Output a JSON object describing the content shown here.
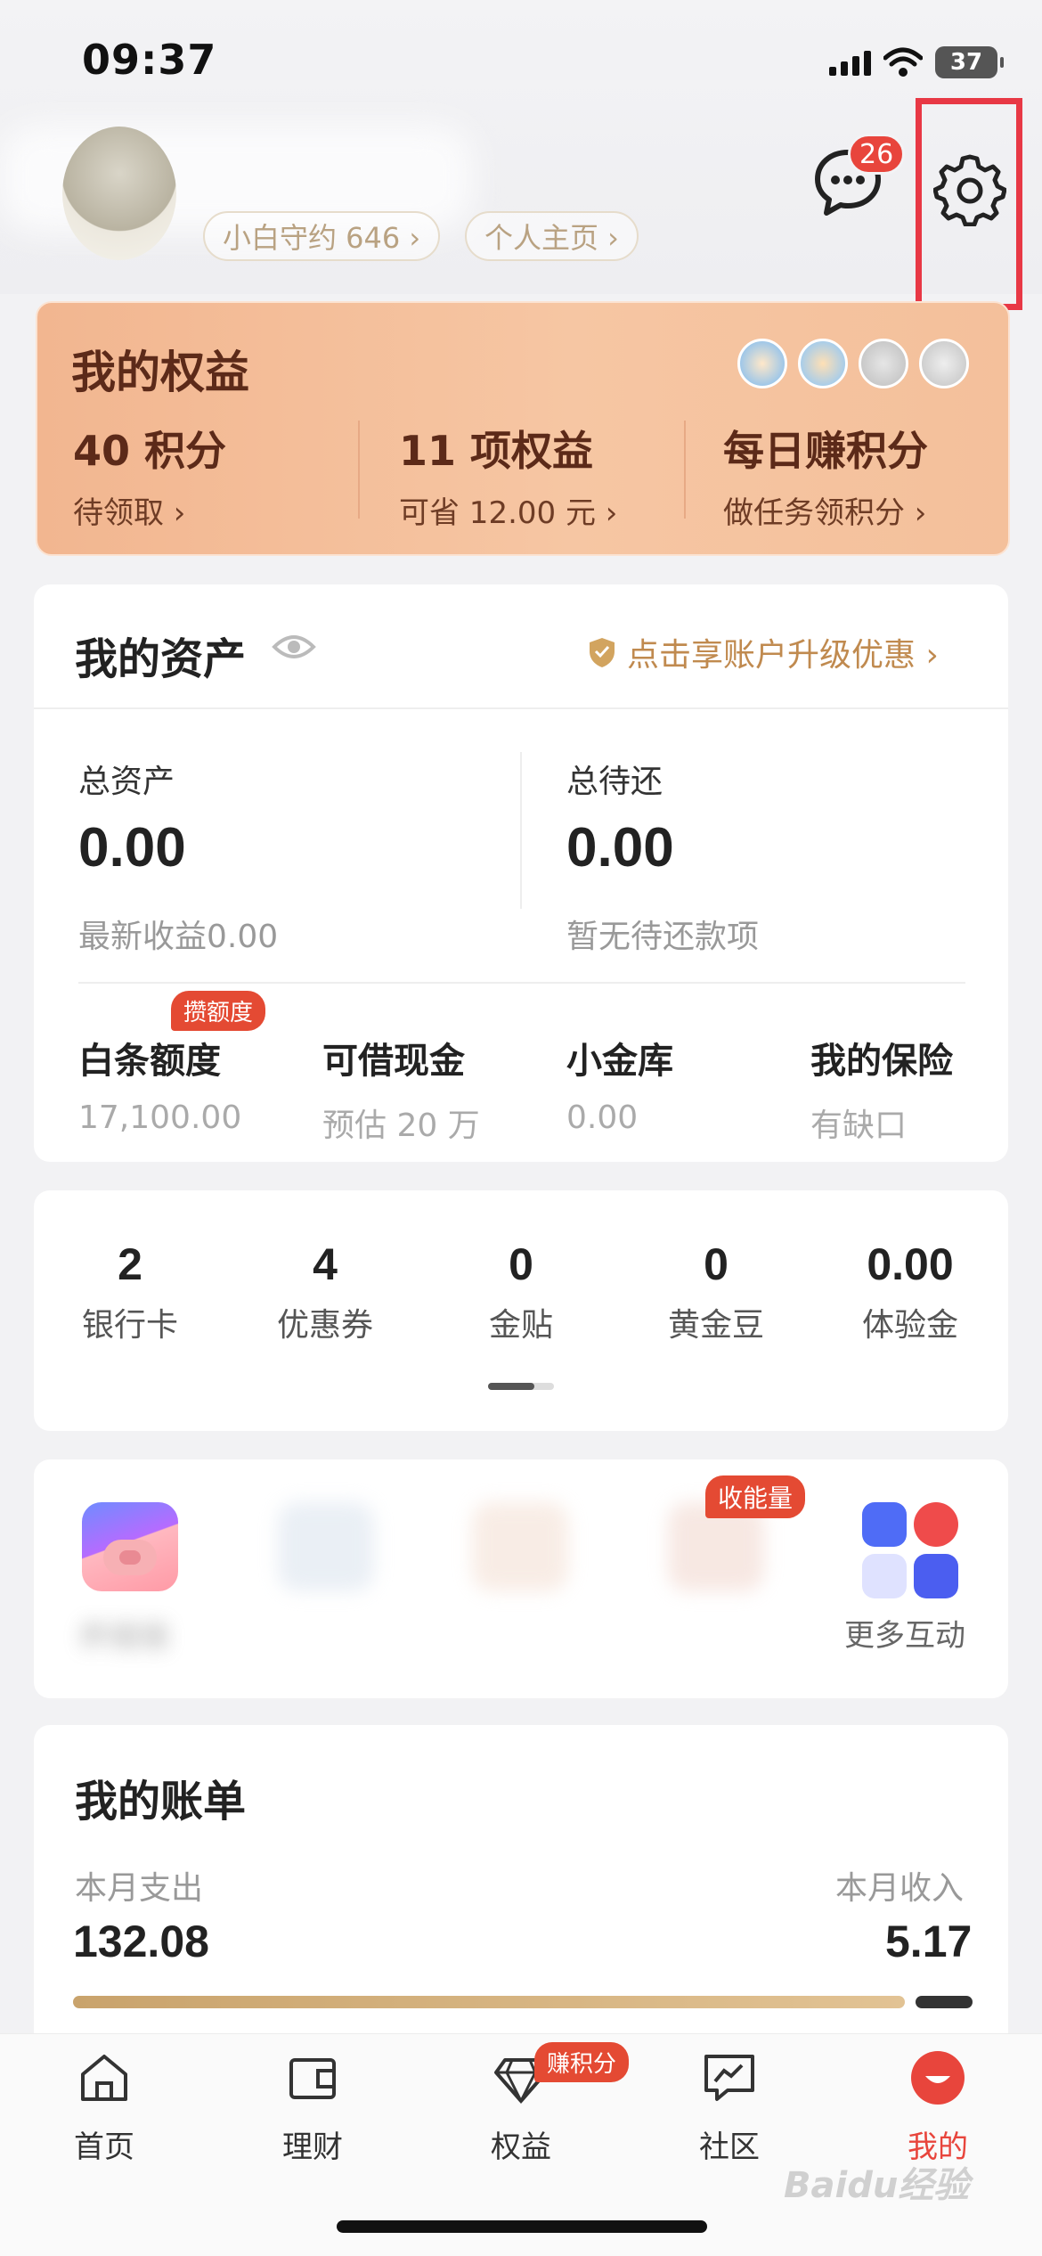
{
  "status_bar": {
    "time": "09:37",
    "battery": "37"
  },
  "header": {
    "contract_pill": "小白守约 646 ›",
    "homepage_pill": "个人主页 ›",
    "message_badge": "26"
  },
  "rights": {
    "title": "我的权益",
    "items": [
      {
        "big": "40 积分",
        "small": "待领取 ›"
      },
      {
        "big": "11 项权益",
        "small": "可省 12.00 元 ›"
      },
      {
        "big": "每日赚积分",
        "small": "做任务领积分 ›"
      }
    ]
  },
  "assets": {
    "title": "我的资产",
    "upgrade_text": "点击享账户升级优惠 ›",
    "total_label": "总资产",
    "total_value": "0.00",
    "total_sub_label": "最新收益",
    "total_sub_value": "0.00",
    "repay_label": "总待还",
    "repay_value": "0.00",
    "repay_sub": "暂无待还款项",
    "tag": "攒额度",
    "quad": [
      {
        "label": "白条额度",
        "value": "17,100.00"
      },
      {
        "label": "可借现金",
        "value": "预估 20 万"
      },
      {
        "label": "小金库",
        "value": "0.00"
      },
      {
        "label": "我的保险",
        "value": "有缺口"
      }
    ]
  },
  "stats": [
    {
      "num": "2",
      "label": "银行卡"
    },
    {
      "num": "4",
      "label": "优惠券"
    },
    {
      "num": "0",
      "label": "金贴"
    },
    {
      "num": "0",
      "label": "黄金豆"
    },
    {
      "num": "0.00",
      "label": "体验金"
    }
  ],
  "apps": {
    "tag": "收能量",
    "first_label": "养猪猪",
    "more_label": "更多互动"
  },
  "bill": {
    "title": "我的账单",
    "expense_label": "本月支出",
    "expense_value": "132.08",
    "income_label": "本月收入",
    "income_value": "5.17"
  },
  "nav": {
    "items": [
      {
        "label": "首页",
        "icon": "home-icon"
      },
      {
        "label": "理财",
        "icon": "wallet-icon"
      },
      {
        "label": "权益",
        "icon": "diamond-icon"
      },
      {
        "label": "社区",
        "icon": "community-icon"
      },
      {
        "label": "我的",
        "icon": "profile-icon"
      }
    ],
    "points_tag": "赚积分",
    "active_color": "#e8453c"
  },
  "watermark": "Baidu经验"
}
